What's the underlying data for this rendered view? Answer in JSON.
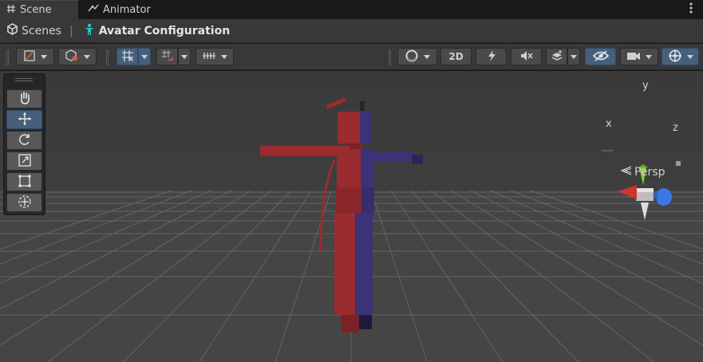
{
  "tabs": [
    {
      "label": "Scene",
      "icon": "grid-icon",
      "active": true
    },
    {
      "label": "Animator",
      "icon": "animator-icon",
      "active": false
    }
  ],
  "tab_menu_icon": "more-vert-icon",
  "breadcrumb": {
    "root": "Scenes",
    "separator": "|",
    "current": "Avatar Configuration"
  },
  "toolbar": {
    "left_buttons": [
      {
        "name": "draw-mode-dropdown",
        "icon": "paint-mode-icon"
      },
      {
        "name": "shading-mode-dropdown",
        "icon": "wire-cube-icon"
      },
      {
        "name": "grid-snap-toggle",
        "icon": "grid-snap-icon",
        "on": true
      },
      {
        "name": "increment-snap-dropdown",
        "icon": "increment-snap-icon"
      },
      {
        "name": "snap-ruler-dropdown",
        "icon": "ruler-icon"
      }
    ],
    "right_buttons": [
      {
        "name": "shading-sphere-dropdown",
        "icon": "sphere-icon"
      },
      {
        "name": "2d-toggle",
        "label": "2D"
      },
      {
        "name": "lighting-toggle",
        "icon": "light-icon"
      },
      {
        "name": "audio-toggle",
        "icon": "mute-icon"
      },
      {
        "name": "effects-dropdown",
        "icon": "layers-icon"
      },
      {
        "name": "hidden-objects-toggle",
        "icon": "eye-off-icon",
        "on": true
      },
      {
        "name": "camera-dropdown",
        "icon": "camera-icon"
      },
      {
        "name": "gizmos-dropdown",
        "icon": "gizmo-icon",
        "on": true
      }
    ]
  },
  "tools": [
    {
      "name": "hand-tool",
      "icon": "hand-icon"
    },
    {
      "name": "move-tool",
      "icon": "move-icon",
      "on": true
    },
    {
      "name": "rotate-tool",
      "icon": "rotate-icon"
    },
    {
      "name": "scale-tool",
      "icon": "scale-icon"
    },
    {
      "name": "rect-tool",
      "icon": "rect-transform-icon"
    },
    {
      "name": "transform-tool",
      "icon": "transform-icon"
    }
  ],
  "gizmo": {
    "x_label": "x",
    "y_label": "y",
    "z_label": "z",
    "projection": "Persp",
    "colors": {
      "x": "#c8372b",
      "y": "#8ac83a",
      "z": "#3a78e6"
    }
  },
  "colors": {
    "accent_on": "#46607c",
    "viewport_bg": "#3c3c3c",
    "avatar_left": "#9a2b2f",
    "avatar_right": "#3b3277"
  }
}
